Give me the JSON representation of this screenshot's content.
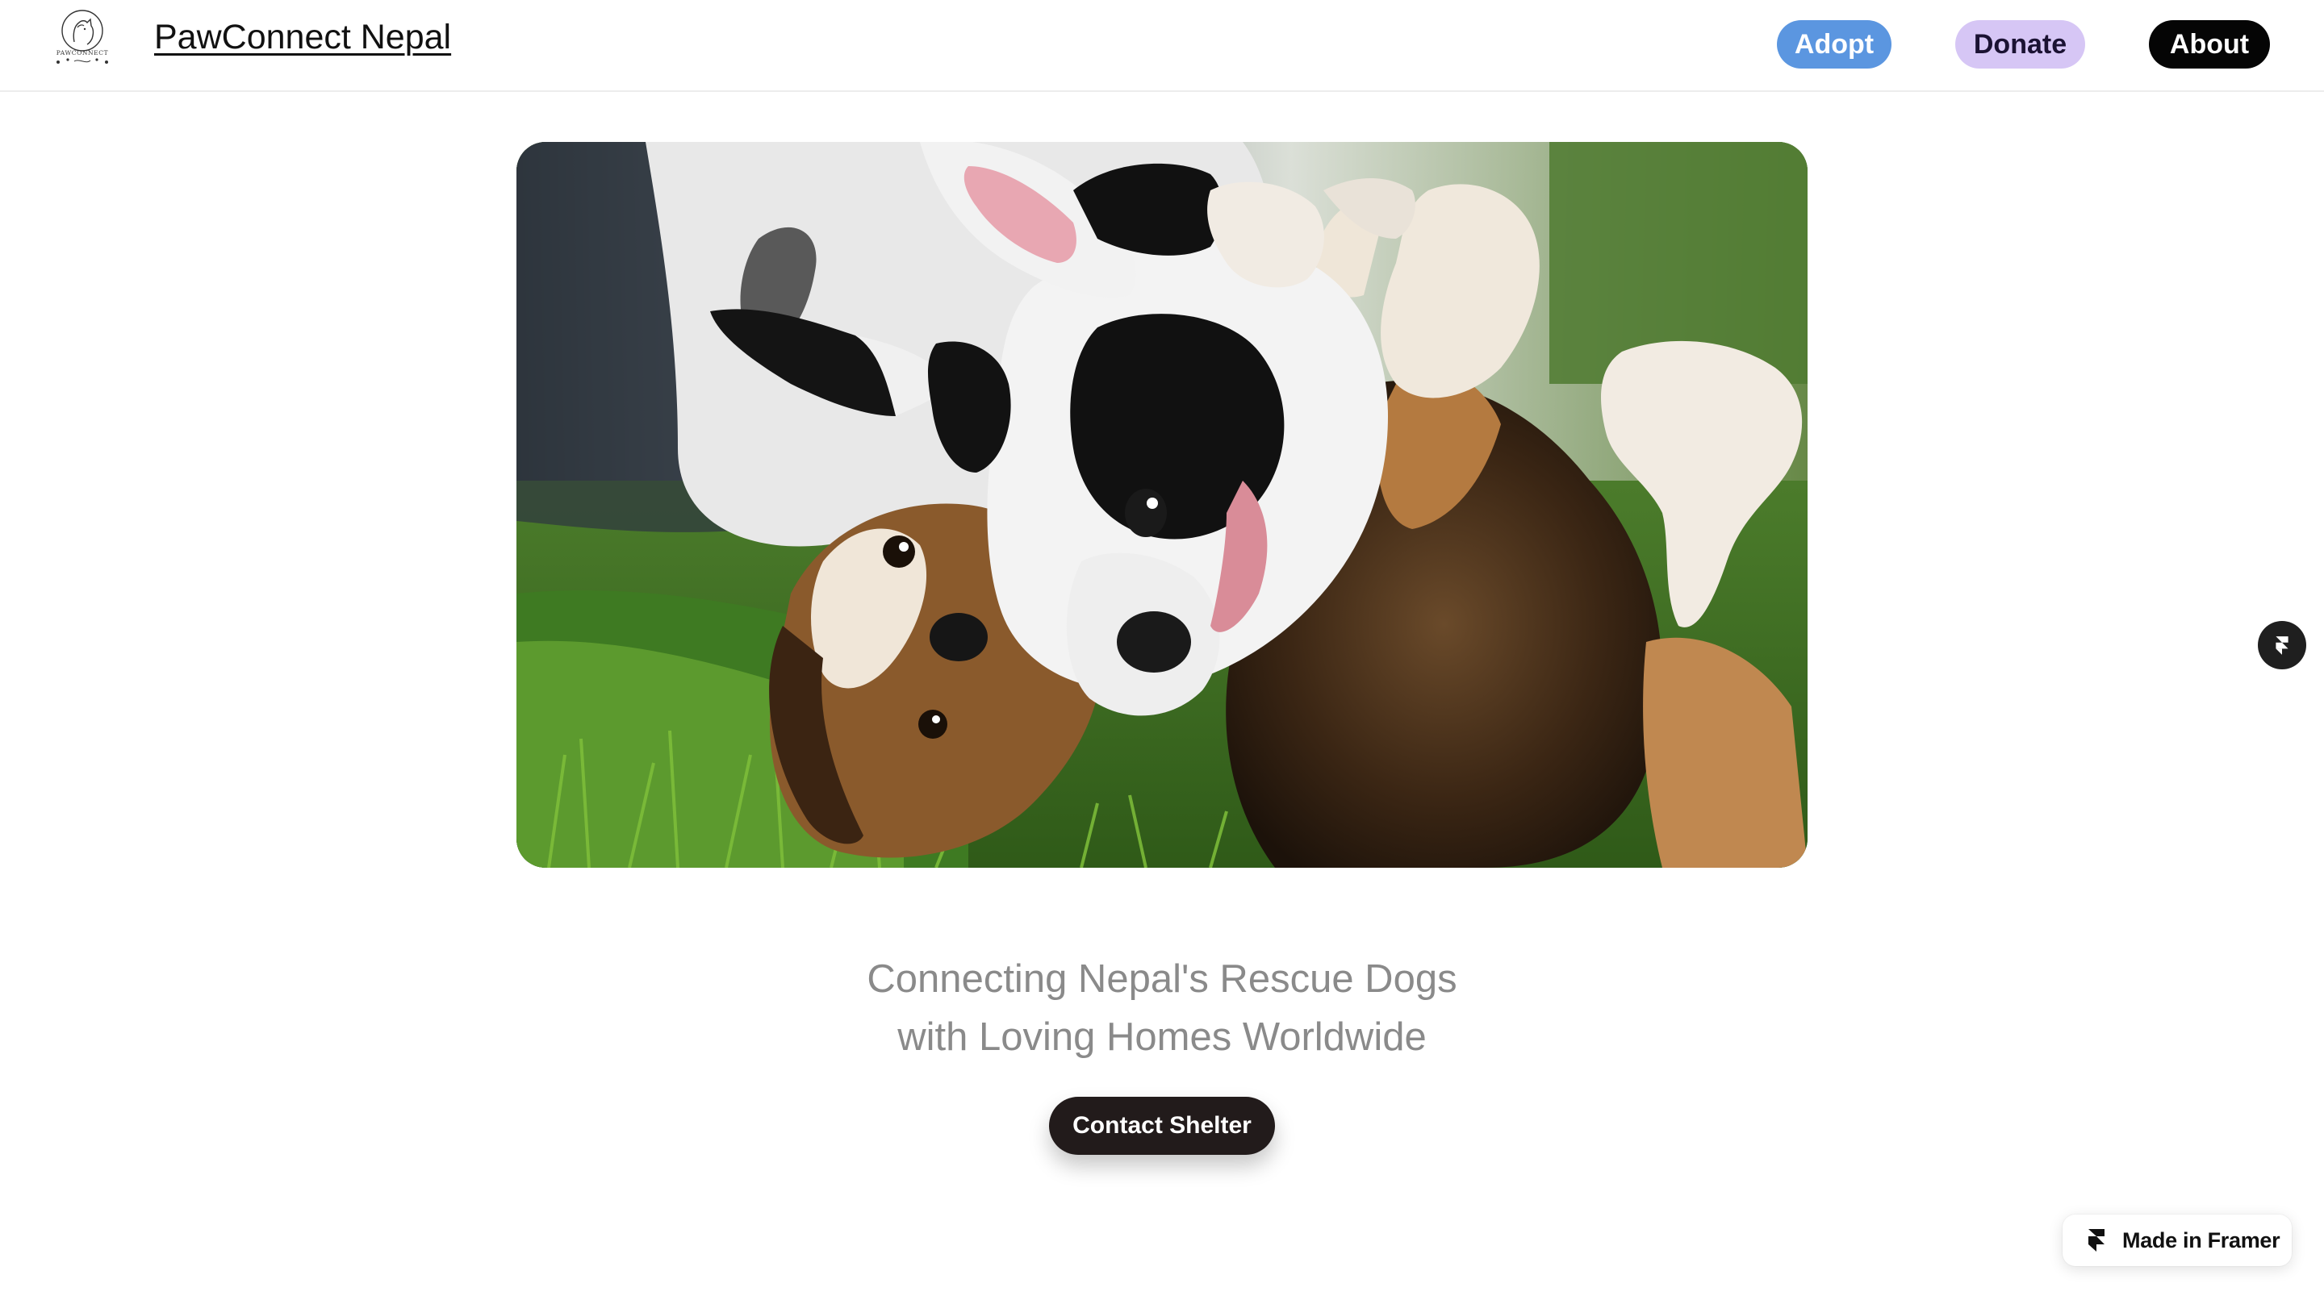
{
  "header": {
    "logo_text": "PAWCONNECT",
    "brand": "PawConnect Nepal",
    "nav": {
      "adopt": "Adopt",
      "donate": "Donate",
      "about": "About"
    }
  },
  "hero": {
    "image_subject": "two dogs playing in grass"
  },
  "main": {
    "tagline_line1": "Connecting Nepal's Rescue Dogs",
    "tagline_line2": "with Loving Homes Worldwide",
    "cta_label": "Contact Shelter"
  },
  "framer_badge": {
    "label": "Made in Framer",
    "icon": "framer-logo-icon"
  },
  "colors": {
    "adopt_bg": "#5b96e0",
    "donate_bg": "#d6c6f5",
    "about_bg": "#050505",
    "cta_bg": "#221b1b",
    "tagline": "#8a8a8a"
  }
}
